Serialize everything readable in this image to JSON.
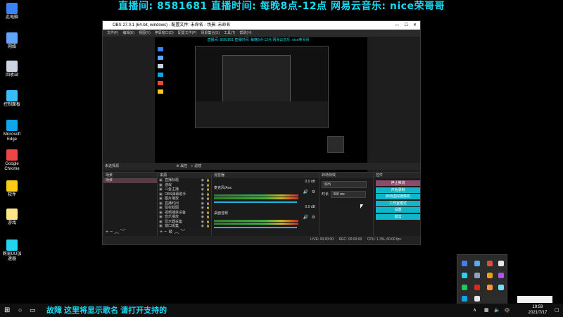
{
  "banner": {
    "text": "直播间: 8581681 直播时间: 每晚8点-12点 网易云音乐: nice荣哥哥"
  },
  "desktop_icons": [
    {
      "label": "此电脑",
      "color": "#3b82f6"
    },
    {
      "label": "网络",
      "color": "#60a5fa"
    },
    {
      "label": "回收站",
      "color": "#cbd5e1"
    },
    {
      "label": "控制面板",
      "color": "#38bdf8"
    },
    {
      "label": "Microsoft Edge",
      "color": "#0ea5e9"
    },
    {
      "label": "Google Chrome",
      "color": "#ef4444"
    },
    {
      "label": "软件",
      "color": "#facc15"
    },
    {
      "label": "游戏",
      "color": "#fde68a"
    },
    {
      "label": "网易UU加速器",
      "color": "#22d3ee"
    }
  ],
  "obs": {
    "title": "OBS 27.0.1 (64-bit, windows) - 配置文件: 未命名 - 场景: 未命名",
    "menu": [
      "文件(F)",
      "编辑(E)",
      "视图(V)",
      "停靠窗口(D)",
      "配置文件(P)",
      "场景集合(S)",
      "工具(T)",
      "帮助(H)"
    ],
    "preview_banner": "直播间: 8581681 直播时间: 每晚8点-12点 网易云音乐: nice荣哥哥",
    "preview_caption": "故障 这里将显示歌名 请打开支持的",
    "source_toolbar": {
      "current": "未选择源",
      "props": "属性",
      "filters": "滤镜"
    },
    "docks": {
      "scenes": {
        "title": "场景",
        "items": [
          "场景"
        ]
      },
      "sources": {
        "title": "来源",
        "items": [
          "直播标题",
          "游戏",
          "斗鱼主播",
          "OBS弹幕助手",
          "图片播放",
          "直播时间",
          "鼠标截图",
          "视频捕获设备",
          "音乐播放",
          "显示器采集",
          "窗口采集"
        ]
      },
      "mixer": {
        "title": "混音器",
        "tracks": [
          {
            "name": "麦克风/Aux",
            "db": "0.0 dB"
          },
          {
            "name": "桌面音频",
            "db": "0.0 dB"
          }
        ]
      },
      "transitions": {
        "title": "转场特效",
        "type": "淡出",
        "duration_label": "时长",
        "duration": "300 ms"
      },
      "controls": {
        "title": "控件",
        "buttons": [
          "停止推流",
          "开始录制",
          "启动虚拟摄像机",
          "工作室模式",
          "设置",
          "退出"
        ]
      }
    },
    "status": {
      "live": "LIVE: 00:00:00",
      "rec": "REC: 00:00:00",
      "cpu": "CPU: 1.3%, 60.00 fps"
    }
  },
  "taskbar": {
    "now_playing": "故障 这里将显示歌名 请打开支持的",
    "time": "19:59",
    "date": "2021/7/17"
  }
}
